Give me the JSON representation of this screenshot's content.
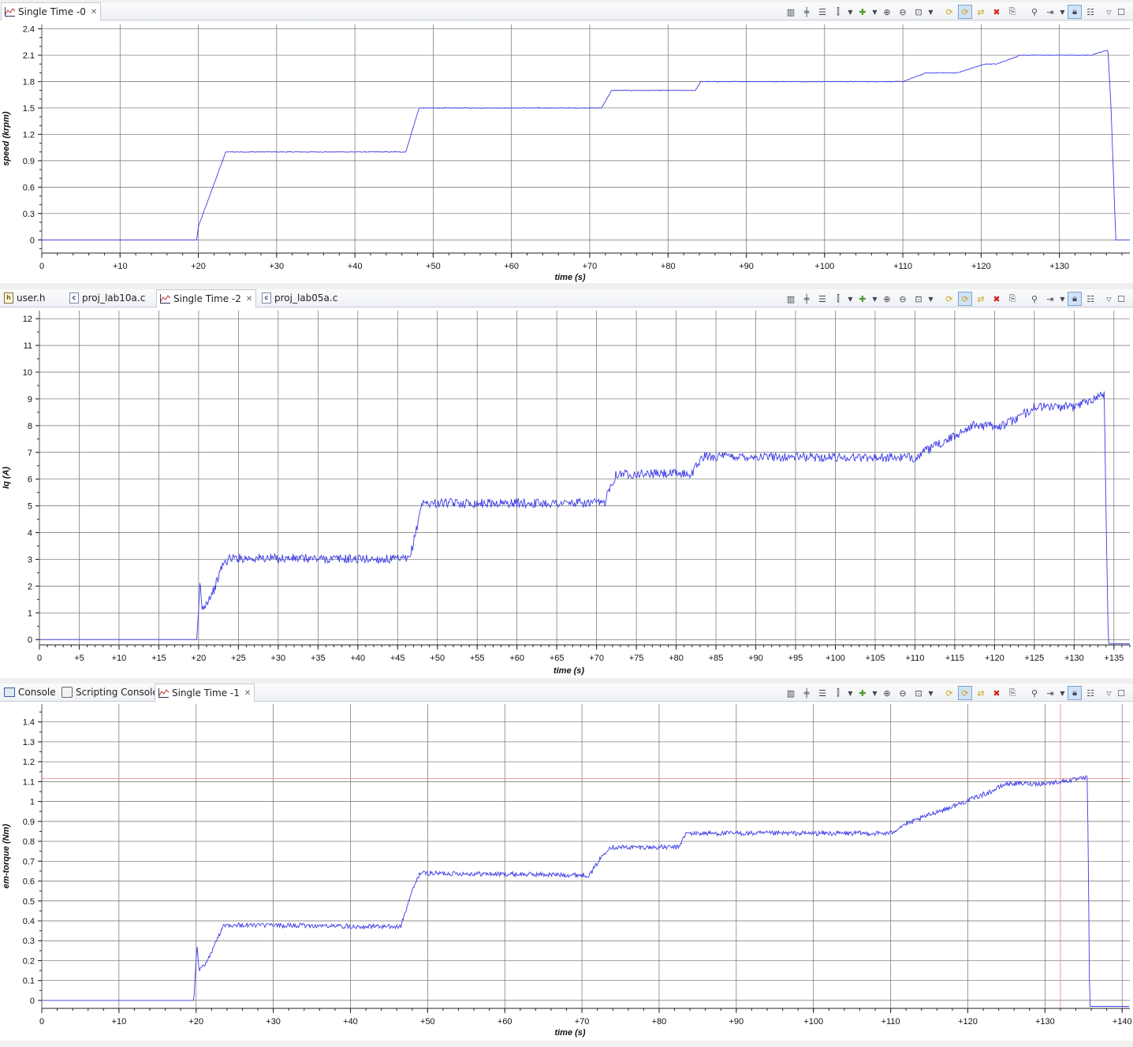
{
  "colors": {
    "trace": "#3c3ce6",
    "grid": "#6e6e6e",
    "cursor": "#f08080"
  },
  "toolbar_icons": [
    "align-icon",
    "center-icon",
    "spread-icon",
    "marker-icon",
    "dropdown-icon",
    "add-icon",
    "dropdown-icon",
    "zoom-in-icon",
    "zoom-out-icon",
    "zoom-fit-icon",
    "dropdown-icon",
    "refresh-icon",
    "auto-refresh-icon",
    "sync-icon",
    "delete-icon",
    "export-icon",
    "binoculars-icon",
    "scroll-icon",
    "dropdown-icon",
    "lock-icon",
    "legend-icon",
    "view-menu-icon",
    "maximize-icon"
  ],
  "pane1": {
    "tabs": [
      {
        "label": "Single Time -0",
        "icon": "chart-icon",
        "active": true,
        "closable": true
      }
    ]
  },
  "pane2": {
    "tabs": [
      {
        "label": "user.h",
        "icon": "header-file-icon",
        "active": false,
        "closable": false
      },
      {
        "label": "proj_lab10a.c",
        "icon": "c-file-icon",
        "active": false,
        "closable": false
      },
      {
        "label": "Single Time -2",
        "icon": "chart-icon",
        "active": true,
        "closable": true
      },
      {
        "label": "proj_lab05a.c",
        "icon": "c-file-icon",
        "active": false,
        "closable": false
      }
    ]
  },
  "pane3": {
    "tabs": [
      {
        "label": "Console",
        "icon": "console-icon",
        "active": false,
        "closable": false
      },
      {
        "label": "Scripting Console",
        "icon": "script-icon",
        "active": false,
        "closable": false
      },
      {
        "label": "Single Time -1",
        "icon": "chart-icon",
        "active": true,
        "closable": true
      }
    ]
  },
  "chart_data": [
    {
      "type": "line",
      "xlabel": "time  (s)",
      "ylabel": "speed  (krpm)",
      "xlim": [
        0,
        139
      ],
      "ylim": [
        -0.15,
        2.45
      ],
      "x_ticks": [
        "0",
        "+10",
        "+20",
        "+30",
        "+40",
        "+50",
        "+60",
        "+70",
        "+80",
        "+90",
        "+100",
        "+110",
        "+120",
        "+130"
      ],
      "y_ticks": [
        "0",
        "0.3",
        "0.6",
        "0.9",
        "1.2",
        "1.5",
        "1.8",
        "2.1",
        "2.4"
      ],
      "grid": true,
      "noise": 0.004,
      "series": [
        {
          "x": [
            0,
            19.8,
            20,
            23.5,
            46.5,
            48.2,
            71.5,
            72.8,
            83.5,
            84.2,
            110,
            113,
            117,
            120.5,
            122,
            125,
            128,
            134,
            136.2,
            136.6,
            137.2,
            139
          ],
          "y": [
            0,
            0,
            0.15,
            1.0,
            1.0,
            1.5,
            1.5,
            1.7,
            1.7,
            1.8,
            1.8,
            1.9,
            1.9,
            2.0,
            2.0,
            2.1,
            2.1,
            2.1,
            2.16,
            1.5,
            0,
            0
          ]
        }
      ]
    },
    {
      "type": "line",
      "xlabel": "time  (s)",
      "ylabel": "Iq  (A)",
      "xlim": [
        0,
        137
      ],
      "ylim": [
        -0.2,
        12.3
      ],
      "x_ticks": [
        "0",
        "+5",
        "+10",
        "+15",
        "+20",
        "+25",
        "+30",
        "+35",
        "+40",
        "+45",
        "+50",
        "+55",
        "+60",
        "+65",
        "+70",
        "+75",
        "+80",
        "+85",
        "+90",
        "+95",
        "+100",
        "+105",
        "+110",
        "+115",
        "+120",
        "+125",
        "+130",
        "+135"
      ],
      "y_ticks": [
        "0",
        "1",
        "2",
        "3",
        "4",
        "5",
        "6",
        "7",
        "8",
        "9",
        "10",
        "11",
        "12"
      ],
      "grid": true,
      "noise": 0.17,
      "series": [
        {
          "x": [
            0,
            19.8,
            20,
            20.2,
            20.4,
            21,
            22,
            23,
            24,
            46.5,
            47.5,
            48,
            71,
            71.5,
            72.5,
            73,
            82,
            82.5,
            83.5,
            110,
            111,
            113,
            115,
            117,
            121,
            123,
            125,
            130,
            133.8,
            134,
            134.3,
            137
          ],
          "y": [
            0,
            0,
            1.0,
            2.3,
            1.1,
            1.4,
            1.9,
            2.8,
            3.05,
            3.0,
            4.3,
            5.1,
            5.1,
            5.6,
            6.2,
            6.2,
            6.2,
            6.5,
            6.85,
            6.8,
            7.0,
            7.3,
            7.6,
            8.0,
            8.0,
            8.3,
            8.7,
            8.7,
            9.2,
            4.7,
            -0.15,
            -0.15
          ]
        }
      ]
    },
    {
      "type": "line",
      "xlabel": "time  (s)",
      "ylabel": "em-torque  (Nm)",
      "xlim": [
        0,
        141
      ],
      "ylim": [
        -0.04,
        1.49
      ],
      "x_ticks": [
        "0",
        "+10",
        "+20",
        "+30",
        "+40",
        "+50",
        "+60",
        "+70",
        "+80",
        "+90",
        "+100",
        "+110",
        "+120",
        "+130",
        "+140"
      ],
      "y_ticks": [
        "0",
        "0.1",
        "0.2",
        "0.3",
        "0.4",
        "0.5",
        "0.6",
        "0.7",
        "0.8",
        "0.9",
        "1",
        "1.1",
        "1.2",
        "1.3",
        "1.4"
      ],
      "grid": true,
      "noise": 0.012,
      "cursor": {
        "x": 132,
        "y": 1.115
      },
      "series": [
        {
          "x": [
            0,
            19.7,
            19.9,
            20.1,
            20.4,
            21.5,
            23,
            23.5,
            46.5,
            48,
            49,
            71,
            72.5,
            73.5,
            82.5,
            83.5,
            110,
            111.5,
            113,
            116,
            117,
            121,
            123,
            125,
            130,
            134,
            135.5,
            135.8,
            141
          ],
          "y": [
            0,
            0,
            0.15,
            0.28,
            0.15,
            0.2,
            0.33,
            0.38,
            0.37,
            0.55,
            0.64,
            0.63,
            0.72,
            0.77,
            0.77,
            0.84,
            0.84,
            0.88,
            0.9,
            0.95,
            0.96,
            1.02,
            1.05,
            1.09,
            1.09,
            1.11,
            1.12,
            -0.03,
            -0.03
          ]
        }
      ]
    }
  ]
}
